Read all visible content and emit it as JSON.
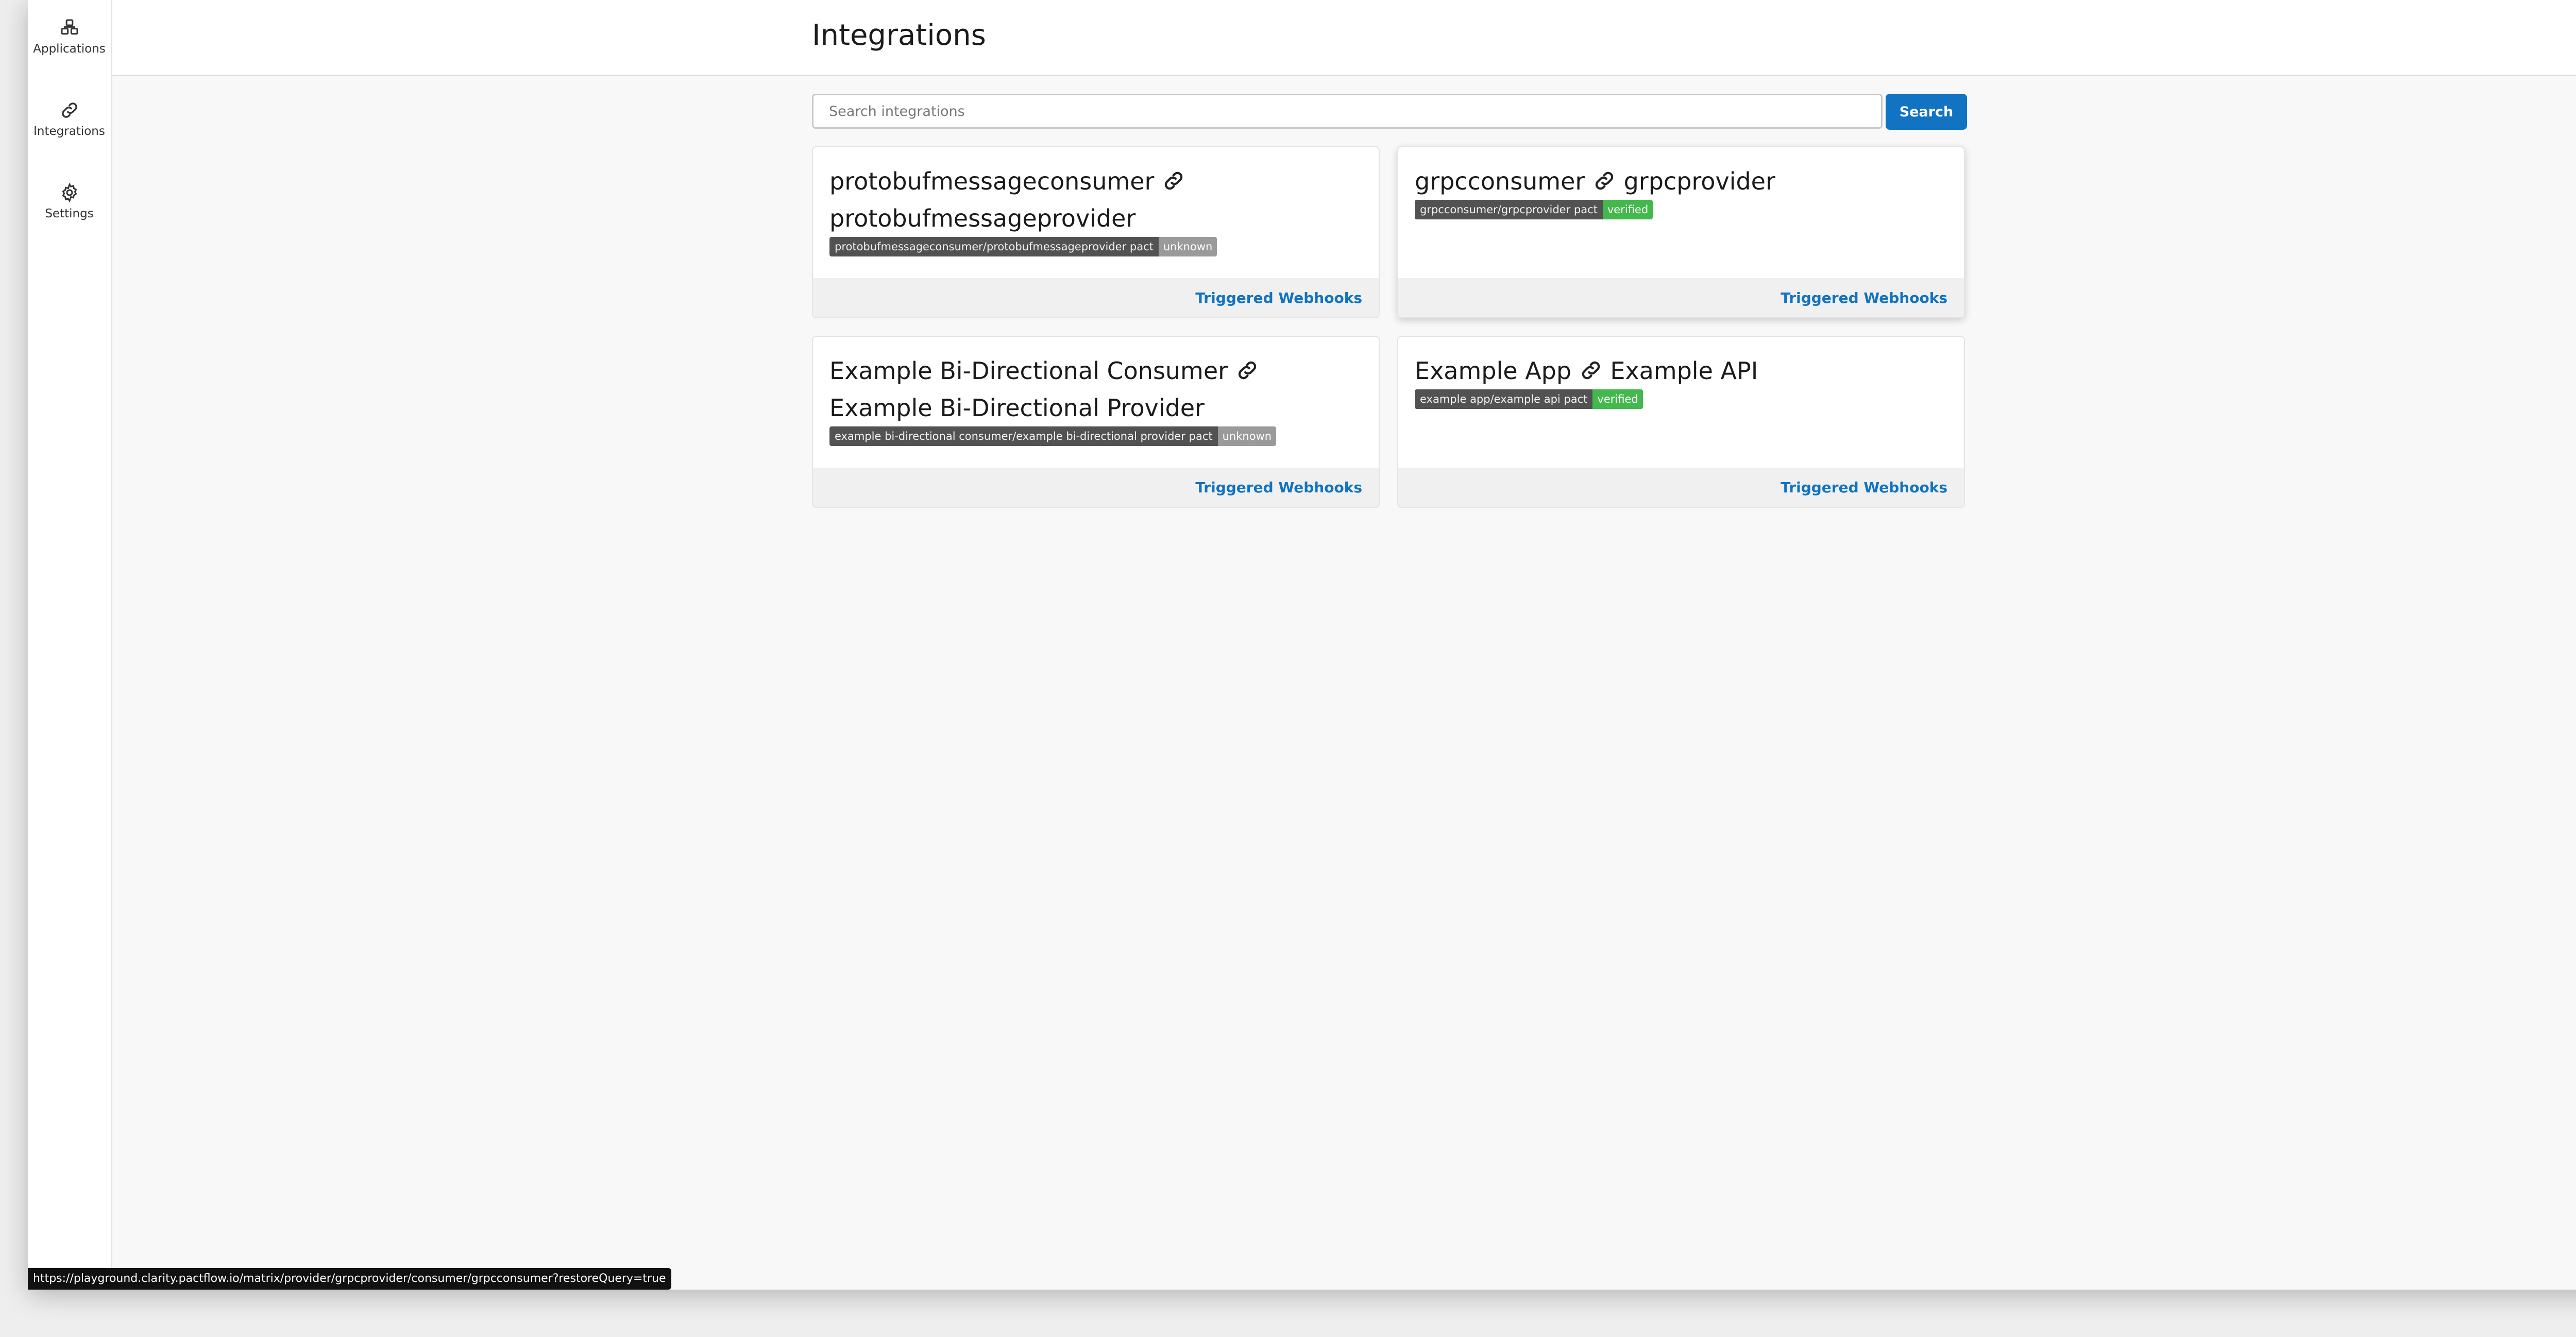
{
  "sidebar": {
    "items": [
      {
        "label": "Applications",
        "icon": "applications-icon"
      },
      {
        "label": "Integrations",
        "icon": "link-icon"
      },
      {
        "label": "Settings",
        "icon": "gear-icon"
      }
    ]
  },
  "header": {
    "title": "Integrations"
  },
  "search": {
    "placeholder": "Search integrations",
    "value": "",
    "button_label": "Search"
  },
  "integrations": [
    {
      "consumer": "protobufmessageconsumer",
      "provider": "protobufmessageprovider",
      "pact_label": "protobufmessageconsumer/protobufmessageprovider pact",
      "status": "unknown",
      "footer_link": "Triggered Webhooks"
    },
    {
      "consumer": "grpcconsumer",
      "provider": "grpcprovider",
      "pact_label": "grpcconsumer/grpcprovider pact",
      "status": "verified",
      "footer_link": "Triggered Webhooks"
    },
    {
      "consumer": "Example Bi-Directional Consumer",
      "provider": "Example Bi-Directional Provider",
      "pact_label": "example bi-directional consumer/example bi-directional provider pact",
      "status": "unknown",
      "footer_link": "Triggered Webhooks"
    },
    {
      "consumer": "Example App",
      "provider": "Example API",
      "pact_label": "example app/example api pact",
      "status": "verified",
      "footer_link": "Triggered Webhooks"
    }
  ],
  "status_bar": {
    "url": "https://playground.clarity.pactflow.io/matrix/provider/grpcprovider/consumer/grpcconsumer?restoreQuery=true"
  },
  "colors": {
    "accent": "#1173c1",
    "verified": "#43b84c",
    "unknown": "#9a9a9a",
    "badge_dark": "#525252"
  }
}
